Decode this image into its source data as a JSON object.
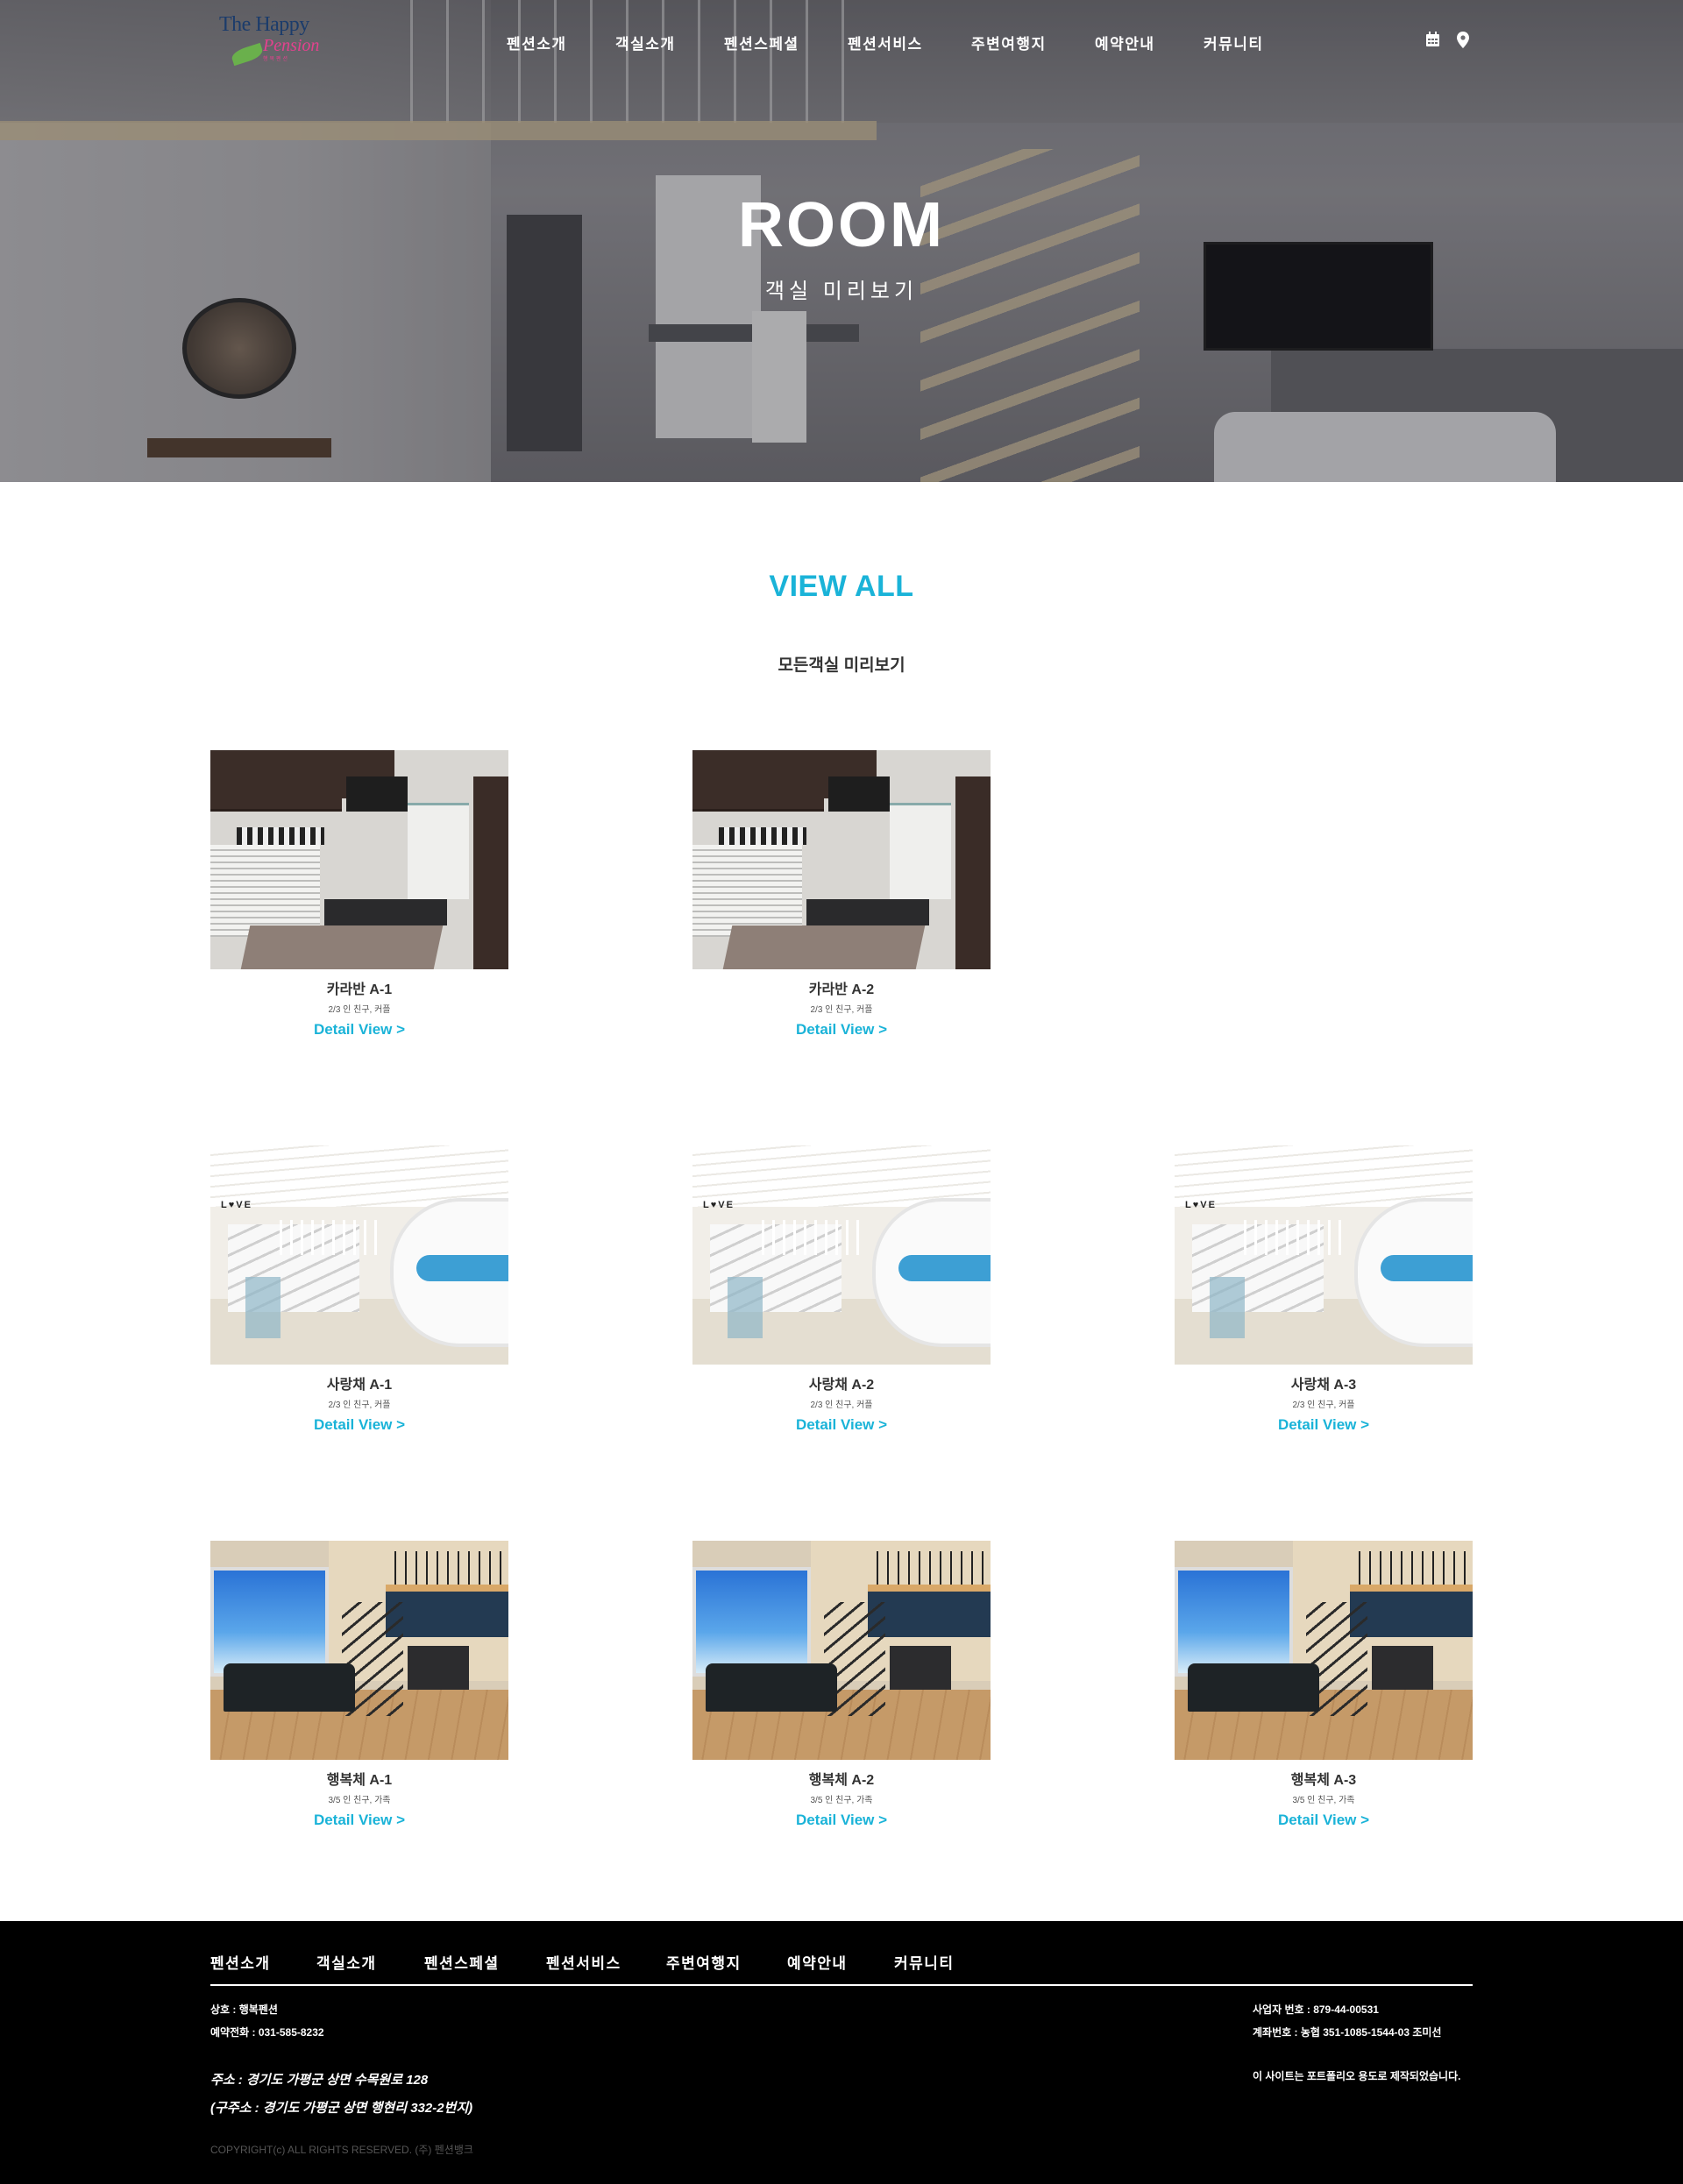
{
  "brand": {
    "logo_line1": "The Happy",
    "logo_line2": "Pension",
    "logo_line3": "행복펜션"
  },
  "nav": {
    "items": [
      "펜션소개",
      "객실소개",
      "펜션스페셜",
      "펜션서비스",
      "주변여행지",
      "예약안내",
      "커뮤니티"
    ],
    "icons": [
      "calendar-icon",
      "map-marker-icon"
    ]
  },
  "hero": {
    "title": "ROOM",
    "subtitle": "객실 미리보기"
  },
  "section": {
    "title": "VIEW ALL",
    "subtitle": "모든객실 미리보기"
  },
  "rooms": [
    {
      "name": "카라반 A-1",
      "caption": "2/3 인 친구, 커플",
      "link": "Detail View >"
    },
    {
      "name": "카라반 A-2",
      "caption": "2/3 인 친구, 커플",
      "link": "Detail View >"
    },
    {
      "name": "사랑채 A-1",
      "caption": "2/3 인 친구, 커플",
      "link": "Detail View >"
    },
    {
      "name": "사랑채 A-2",
      "caption": "2/3 인 친구, 커플",
      "link": "Detail View >"
    },
    {
      "name": "사랑채 A-3",
      "caption": "2/3 인 친구, 커플",
      "link": "Detail View >"
    },
    {
      "name": "행복체 A-1",
      "caption": "3/5 인 친구, 가족",
      "link": "Detail View >"
    },
    {
      "name": "행복체 A-2",
      "caption": "3/5 인 친구, 가족",
      "link": "Detail View >"
    },
    {
      "name": "행복체 A-3",
      "caption": "3/5 인 친구, 가족",
      "link": "Detail View >"
    }
  ],
  "footer": {
    "nav": [
      "펜션소개",
      "객실소개",
      "펜션스페셜",
      "펜션서비스",
      "주변여행지",
      "예약안내",
      "커뮤니티"
    ],
    "company": "상호 : 행복펜션",
    "phone": "예약전화 : 031-585-8232",
    "address": "주소 : 경기도 가평군 상면 수목원로 128",
    "old_address": "(구주소 : 경기도 가평군 상면 행현리 332-2번지)",
    "biz_no": "사업자 번호 : 879-44-00531",
    "account": "계좌번호 : 농협 351-1085-1544-03 조미선",
    "notice": "이 사이트는 포트폴리오 용도로 제작되었습니다.",
    "copyright": "COPYRIGHT(c) ALL RIGHTS RESERVED. (주) 펜션뱅크"
  },
  "colors": {
    "accent": "#1ab3d8",
    "footer_bg": "#000000"
  }
}
